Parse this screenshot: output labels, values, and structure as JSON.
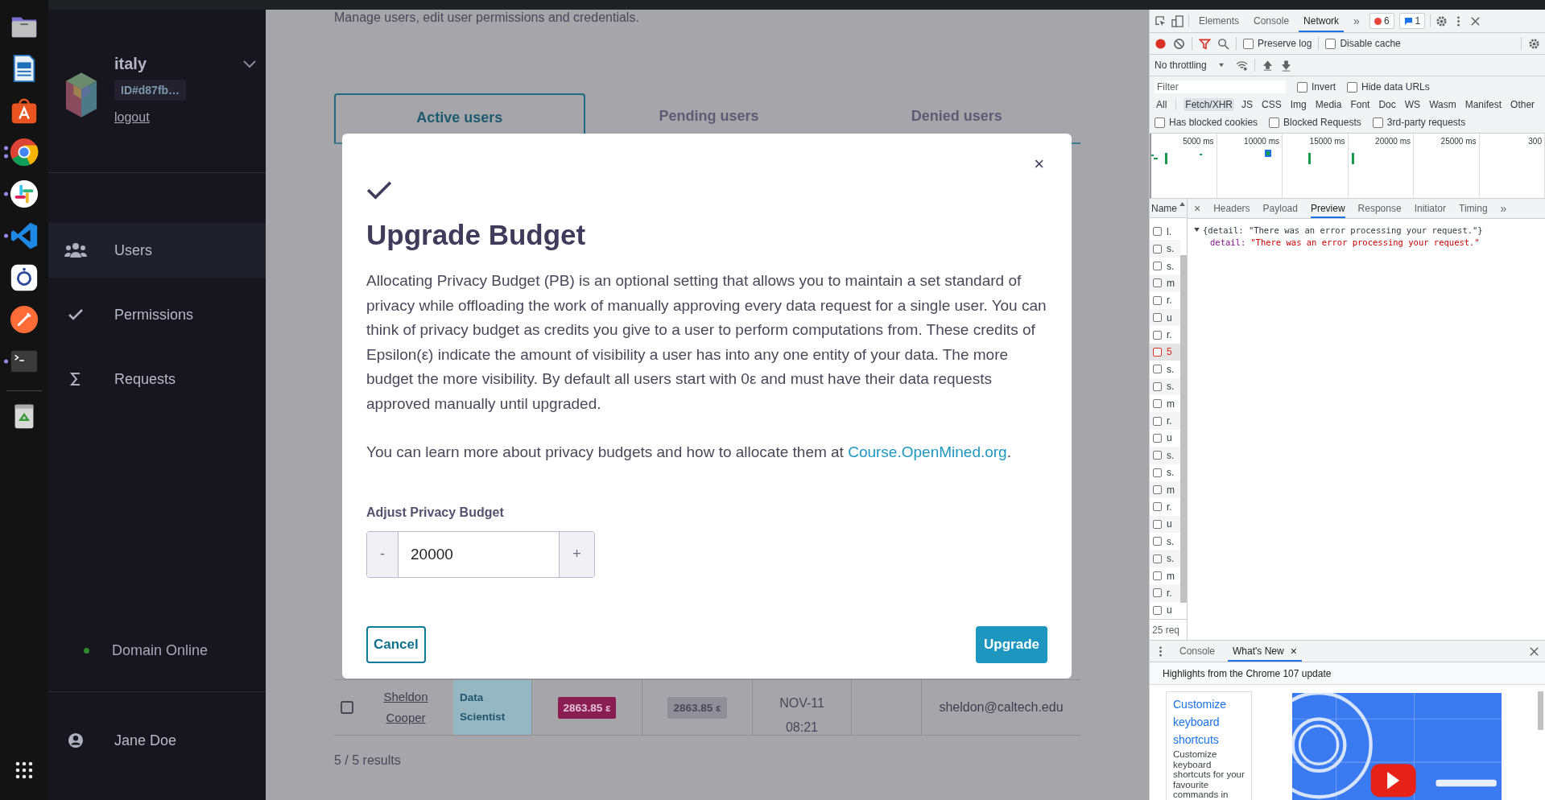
{
  "dock": {
    "apps": [
      {
        "kind": "files",
        "running": false,
        "multiple": false
      },
      {
        "kind": "writer",
        "running": false,
        "multiple": false
      },
      {
        "kind": "store",
        "running": false,
        "multiple": false
      },
      {
        "kind": "chrome",
        "running": true,
        "multiple": true
      },
      {
        "kind": "slack",
        "running": true,
        "multiple": false
      },
      {
        "kind": "vscode",
        "running": true,
        "multiple": false
      },
      {
        "kind": "pop",
        "running": false,
        "multiple": false
      },
      {
        "kind": "postman",
        "running": false,
        "multiple": false
      },
      {
        "kind": "terminal",
        "running": true,
        "multiple": false
      },
      {
        "kind": "trash",
        "running": false,
        "multiple": false
      }
    ]
  },
  "sidebar": {
    "domain_name": "italy",
    "domain_id": "ID#d87fb…",
    "logout": "logout",
    "nav": [
      {
        "kind": "users",
        "label": "Users",
        "selected": true
      },
      {
        "kind": "check",
        "label": "Permissions",
        "selected": false
      },
      {
        "kind": "sigma",
        "label": "Requests",
        "selected": false
      }
    ],
    "status": {
      "label": "Domain Online",
      "online": true
    },
    "user": "Jane Doe"
  },
  "page": {
    "subtitle": "Manage users, edit user permissions and credentials.",
    "tabs": [
      {
        "label": "Active users",
        "selected": true
      },
      {
        "label": "Pending users",
        "selected": false
      },
      {
        "label": "Denied users",
        "selected": false
      }
    ],
    "row": {
      "checked": false,
      "name": "Sheldon Cooper",
      "role": "Data Scientist",
      "budget": "2863.85 ε",
      "spent": "2863.85 ε",
      "date": "NOV-11",
      "time": "08:21",
      "email": "sheldon@caltech.edu"
    },
    "results": "5 / 5 results"
  },
  "modal": {
    "close": "×",
    "title": "Upgrade Budget",
    "paragraph": "Allocating Privacy Budget (PB) is an optional setting that allows you to maintain a set standard of privacy while offloading the work of manually approving every data request for a single user. You can think of privacy budget as credits you give to a user to perform computations from. These credits of Epsilon(ε) indicate the amount of visibility a user has into any one entity of your data. The more budget the more visibility. By default all users start with 0ε and must have their data requests approved manually until upgraded.",
    "learn_more": "You can learn more about privacy budgets and how to allocate them at",
    "link": "Course.OpenMined.org",
    "link_after": ".",
    "field_label": "Adjust Privacy Budget",
    "minus": "-",
    "value": "20000",
    "plus": "+",
    "cancel": "Cancel",
    "confirm": "Upgrade"
  },
  "devtools": {
    "tabs": [
      {
        "label": "Elements",
        "selected": false
      },
      {
        "label": "Console",
        "selected": false
      },
      {
        "label": "Network",
        "selected": true
      }
    ],
    "more": "»",
    "errors": "6",
    "messages": "1",
    "preserve_log": {
      "label": "Preserve log",
      "checked": false
    },
    "disable_cache": {
      "label": "Disable cache",
      "checked": false
    },
    "throttling": "No throttling",
    "filter_placeholder": "Filter",
    "invert": {
      "label": "Invert",
      "checked": false
    },
    "hide_data_urls": {
      "label": "Hide data URLs",
      "checked": false
    },
    "types": [
      {
        "label": "All",
        "selected": false
      },
      {
        "label": "Fetch/XHR",
        "selected": true
      },
      {
        "label": "JS",
        "selected": false
      },
      {
        "label": "CSS",
        "selected": false
      },
      {
        "label": "Img",
        "selected": false
      },
      {
        "label": "Media",
        "selected": false
      },
      {
        "label": "Font",
        "selected": false
      },
      {
        "label": "Doc",
        "selected": false
      },
      {
        "label": "WS",
        "selected": false
      },
      {
        "label": "Wasm",
        "selected": false
      },
      {
        "label": "Manifest",
        "selected": false
      },
      {
        "label": "Other",
        "selected": false
      }
    ],
    "more_filters": [
      {
        "label": "Has blocked cookies",
        "checked": false
      },
      {
        "label": "Blocked Requests",
        "checked": false
      },
      {
        "label": "3rd-party requests",
        "checked": false
      }
    ],
    "timeline_ticks": [
      "5000 ms",
      "10000 ms",
      "15000 ms",
      "20000 ms",
      "25000 ms",
      "300"
    ],
    "name_header": "Name",
    "requests": [
      {
        "name": "l.",
        "error": false,
        "checked": false
      },
      {
        "name": "s.",
        "error": false,
        "checked": false
      },
      {
        "name": "s.",
        "error": false,
        "checked": false
      },
      {
        "name": "m",
        "error": false,
        "checked": false
      },
      {
        "name": "r.",
        "error": false,
        "checked": false
      },
      {
        "name": "u",
        "error": false,
        "checked": false
      },
      {
        "name": "r.",
        "error": false,
        "checked": false
      },
      {
        "name": "5",
        "error": true,
        "checked": false
      },
      {
        "name": "s.",
        "error": false,
        "checked": false
      },
      {
        "name": "s.",
        "error": false,
        "checked": false
      },
      {
        "name": "m",
        "error": false,
        "checked": false
      },
      {
        "name": "r.",
        "error": false,
        "checked": false
      },
      {
        "name": "u",
        "error": false,
        "checked": false
      },
      {
        "name": "s.",
        "error": false,
        "checked": false
      },
      {
        "name": "s.",
        "error": false,
        "checked": false
      },
      {
        "name": "m",
        "error": false,
        "checked": false
      },
      {
        "name": "r.",
        "error": false,
        "checked": false
      },
      {
        "name": "u",
        "error": false,
        "checked": false
      },
      {
        "name": "s.",
        "error": false,
        "checked": false
      },
      {
        "name": "s.",
        "error": false,
        "checked": false
      },
      {
        "name": "m",
        "error": false,
        "checked": false
      },
      {
        "name": "r.",
        "error": false,
        "checked": false
      },
      {
        "name": "u",
        "error": false,
        "checked": false
      }
    ],
    "request_count": "25 req",
    "detail_close": "×",
    "detail_tabs": [
      {
        "label": "Headers",
        "selected": false
      },
      {
        "label": "Payload",
        "selected": false
      },
      {
        "label": "Preview",
        "selected": true
      },
      {
        "label": "Response",
        "selected": false
      },
      {
        "label": "Initiator",
        "selected": false
      },
      {
        "label": "Timing",
        "selected": false
      }
    ],
    "preview_summary": "{detail: \"There was an error processing your request.\"}",
    "preview_key": "detail:",
    "preview_value": "\"There was an error processing your request.\"",
    "drawer_tabs": [
      {
        "label": "Console",
        "selected": false,
        "closable": false
      },
      {
        "label": "What's New",
        "selected": true,
        "closable": true
      }
    ],
    "drawer_close": "×",
    "highlights": "Highlights from the Chrome 107 update",
    "card_link": "Customize keyboard shortcuts",
    "card_text": "Customize keyboard shortcuts for your favourite commands in"
  }
}
